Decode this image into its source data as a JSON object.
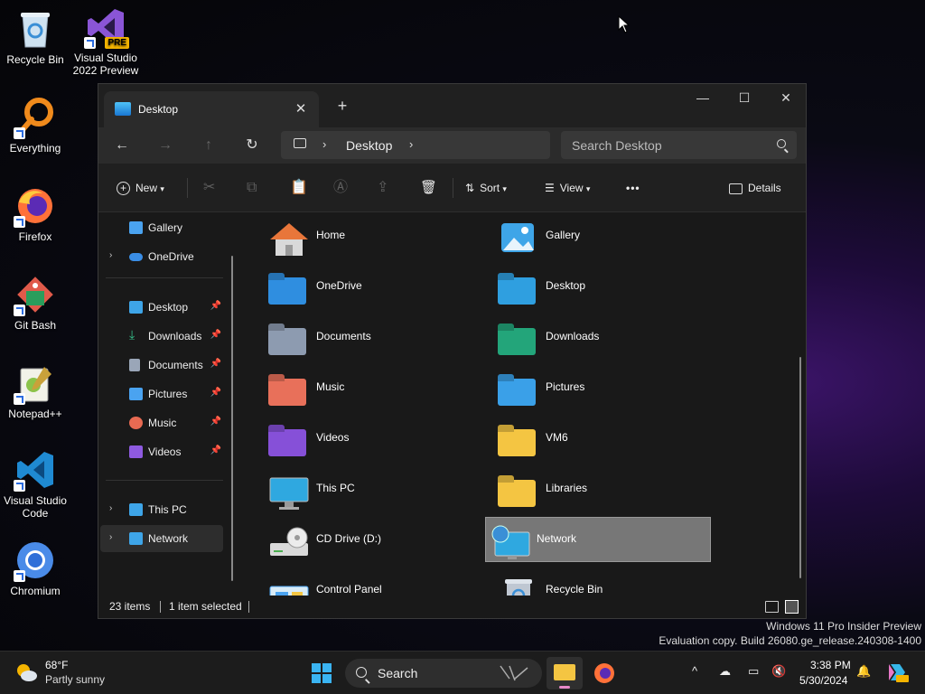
{
  "desktop": {
    "icons": [
      {
        "label": "Recycle Bin",
        "icon": "recycle-bin-icon"
      },
      {
        "label": "Visual Studio 2022 Preview",
        "badge": "PRE",
        "icon": "visual-studio-icon"
      },
      {
        "label": "Everything",
        "icon": "everything-icon"
      },
      {
        "label": "Firefox",
        "icon": "firefox-icon"
      },
      {
        "label": "Git Bash",
        "icon": "git-bash-icon"
      },
      {
        "label": "Notepad++",
        "icon": "notepadpp-icon"
      },
      {
        "label": "Visual Studio Code",
        "icon": "vscode-icon"
      },
      {
        "label": "Chromium",
        "icon": "chromium-icon"
      }
    ],
    "watermark": {
      "line1": "Windows 11 Pro Insider Preview",
      "line2": "Evaluation copy. Build 26080.ge_release.240308-1400"
    }
  },
  "explorer": {
    "tab_title": "Desktop",
    "tab_close": "✕",
    "new_tab": "+",
    "window_controls": {
      "minimize": "—",
      "maximize": "☐",
      "close": "✕"
    },
    "nav": {
      "back": "←",
      "forward": "→",
      "up": "↑",
      "refresh": "↻"
    },
    "address": {
      "separator": "›",
      "crumb": "Desktop"
    },
    "search_placeholder": "Search Desktop",
    "toolbar": {
      "new_label": "New",
      "sort_label": "Sort",
      "view_label": "View",
      "more": "•••",
      "details_label": "Details"
    },
    "sidebar": {
      "top": [
        {
          "label": "Gallery",
          "icon": "gallery-icon",
          "color": "#4aa3f0"
        },
        {
          "label": "OneDrive",
          "icon": "onedrive-icon",
          "color": "#3a8ee6",
          "expander": "›"
        }
      ],
      "pinned": [
        {
          "label": "Desktop",
          "icon": "desktop-icon",
          "color": "#3ea5e8",
          "pin": "📌"
        },
        {
          "label": "Downloads",
          "icon": "downloads-icon",
          "color": "#36c08a",
          "pin": "📌"
        },
        {
          "label": "Documents",
          "icon": "documents-icon",
          "color": "#9aa6b8",
          "pin": "📌"
        },
        {
          "label": "Pictures",
          "icon": "pictures-icon",
          "color": "#4aa3f0",
          "pin": "📌"
        },
        {
          "label": "Music",
          "icon": "music-icon",
          "color": "#e86a52",
          "pin": "📌"
        },
        {
          "label": "Videos",
          "icon": "videos-icon",
          "color": "#8e5ae0",
          "pin": "📌"
        }
      ],
      "bottom": [
        {
          "label": "This PC",
          "icon": "this-pc-icon",
          "color": "#3ea5e8",
          "expander": "›"
        },
        {
          "label": "Network",
          "icon": "network-icon",
          "color": "#3ea5e8",
          "expander": "›"
        }
      ]
    },
    "items": [
      {
        "label": "Home",
        "icon": "home-icon",
        "color": "#e8763a"
      },
      {
        "label": "Gallery",
        "icon": "gallery-icon",
        "color": "#3ea5e8"
      },
      {
        "label": "OneDrive",
        "icon": "onedrive-folder-icon",
        "color": "#2f8ee0"
      },
      {
        "label": "Desktop",
        "icon": "desktop-folder-icon",
        "color": "#2f9fe0"
      },
      {
        "label": "Documents",
        "icon": "documents-folder-icon",
        "color": "#8d9bb0"
      },
      {
        "label": "Downloads",
        "icon": "downloads-folder-icon",
        "color": "#23a57a"
      },
      {
        "label": "Music",
        "icon": "music-folder-icon",
        "color": "#e8705a"
      },
      {
        "label": "Pictures",
        "icon": "pictures-folder-icon",
        "color": "#3aa0e8"
      },
      {
        "label": "Videos",
        "icon": "videos-folder-icon",
        "color": "#8650d8"
      },
      {
        "label": "VM6",
        "icon": "folder-icon",
        "color": "#f4c542"
      },
      {
        "label": "This PC",
        "icon": "this-pc-icon",
        "color": "#2fa8e0"
      },
      {
        "label": "Libraries",
        "icon": "libraries-icon",
        "color": "#f4c542"
      },
      {
        "label": "CD Drive (D:)",
        "icon": "cd-drive-icon",
        "color": "#cfcfcf"
      },
      {
        "label": "Network",
        "icon": "network-icon",
        "color": "#2fa8e0",
        "selected": true
      },
      {
        "label": "Control Panel",
        "icon": "control-panel-icon",
        "color": "#4aa3f0"
      },
      {
        "label": "Recycle Bin",
        "icon": "recycle-bin-icon",
        "color": "#bfc7d2"
      }
    ],
    "status": {
      "count": "23 items",
      "selected": "1 item selected"
    }
  },
  "taskbar": {
    "weather": {
      "temp": "68°F",
      "condition": "Partly sunny"
    },
    "search_label": "Search",
    "clock": {
      "time": "3:38 PM",
      "date": "5/30/2024"
    },
    "tray_chevron": "^"
  }
}
